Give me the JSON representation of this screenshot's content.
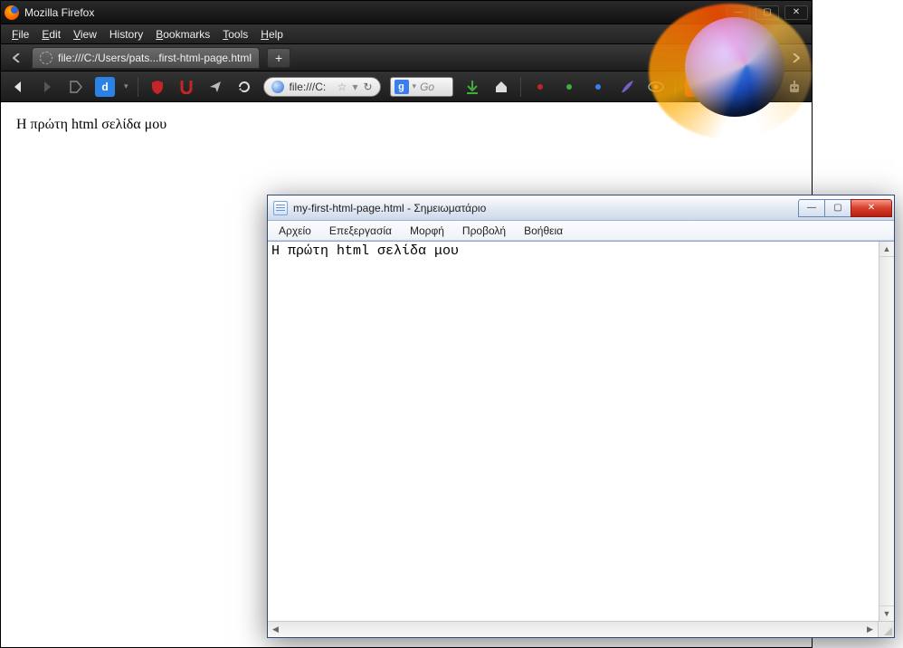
{
  "firefox": {
    "title": "Mozilla Firefox",
    "menu": {
      "file": "File",
      "edit": "Edit",
      "view": "View",
      "history": "History",
      "bookmarks": "Bookmarks",
      "tools": "Tools",
      "help": "Help"
    },
    "tab": {
      "label": "file:///C:/Users/pats...first-html-page.html"
    },
    "newtab_label": "+",
    "urlbar": {
      "text": "file:///C:"
    },
    "searchbox": {
      "placeholder": "Go"
    },
    "page_text": "Η πρώτη html σελίδα μου",
    "icons": {
      "back": "back-icon",
      "forward": "forward-icon",
      "bookmark_d": "d",
      "download": "download-icon",
      "home": "home-icon"
    }
  },
  "notepad": {
    "title": "my-first-html-page.html - Σημειωματάριο",
    "menu": {
      "file": "Αρχείο",
      "edit": "Επεξεργασία",
      "format": "Μορφή",
      "view": "Προβολή",
      "help": "Βοήθεια"
    },
    "content": "Η πρώτη html σελίδα μου"
  },
  "colors": {
    "firefox_chrome": "#222",
    "notepad_close": "#d94330",
    "accent_blue": "#3b7ded"
  }
}
